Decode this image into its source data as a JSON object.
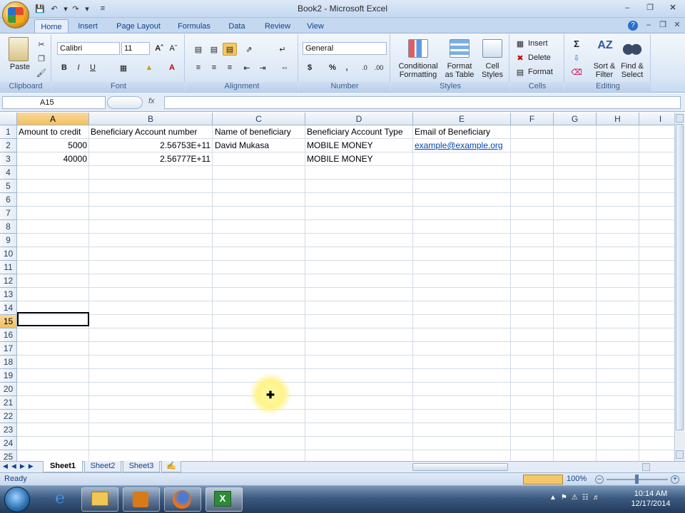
{
  "window": {
    "title": "Book2 - Microsoft Excel"
  },
  "tabs": [
    "Home",
    "Insert",
    "Page Layout",
    "Formulas",
    "Data",
    "Review",
    "View"
  ],
  "ribbon": {
    "clipboard": {
      "label": "Clipboard",
      "paste": "Paste"
    },
    "font": {
      "label": "Font",
      "name": "Calibri",
      "size": "11",
      "bold": "B",
      "italic": "I",
      "underline": "U"
    },
    "alignment": {
      "label": "Alignment"
    },
    "number": {
      "label": "Number",
      "format": "General",
      "currency": "$",
      "percent": "%",
      "comma": ","
    },
    "styles": {
      "label": "Styles",
      "conditional": "Conditional",
      "formatting": "Formatting",
      "format_as": "Format",
      "as_table": "as Table",
      "cell": "Cell",
      "cell_styles": "Styles"
    },
    "cells": {
      "label": "Cells",
      "insert": "Insert",
      "delete": "Delete",
      "format": "Format"
    },
    "editing": {
      "label": "Editing",
      "sort": "Sort &",
      "filter": "Filter",
      "find": "Find &",
      "select": "Select"
    }
  },
  "formula_bar": {
    "name_box": "A15",
    "fx": "fx",
    "value": ""
  },
  "columns": [
    "A",
    "B",
    "C",
    "D",
    "E",
    "F",
    "G",
    "H",
    "I"
  ],
  "rows": [
    "1",
    "2",
    "3",
    "4",
    "5",
    "6",
    "7",
    "8",
    "9",
    "10",
    "11",
    "12",
    "13",
    "14",
    "15",
    "16",
    "17",
    "18",
    "19",
    "20",
    "21",
    "22",
    "23",
    "24",
    "25"
  ],
  "cells": {
    "A1": "Amount to credit",
    "B1": "Beneficiary Account number",
    "C1": "Name of beneficiary",
    "D1": "Beneficiary Account Type",
    "E1": "Email of Beneficiary",
    "A2": "5000",
    "B2": "2.56753E+11",
    "C2": "David Mukasa",
    "D2": "MOBILE MONEY",
    "E2": "example@example.org",
    "A3": "40000",
    "B3": "2.56777E+11",
    "D3": "MOBILE MONEY"
  },
  "sheets": [
    "Sheet1",
    "Sheet2",
    "Sheet3"
  ],
  "status": {
    "ready": "Ready",
    "zoom": "100%"
  },
  "taskbar": {
    "time": "10:14 AM",
    "date": "12/17/2014"
  }
}
